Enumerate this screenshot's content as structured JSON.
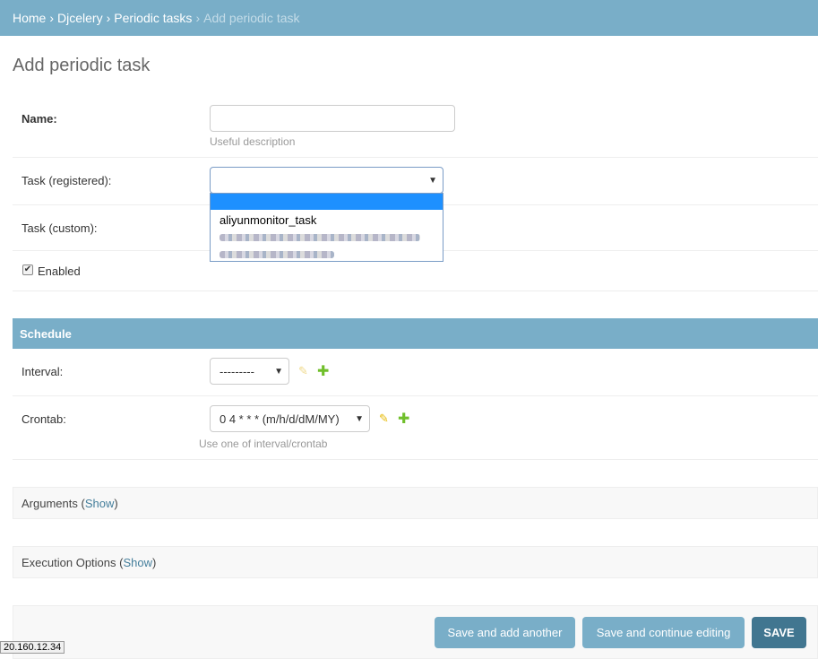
{
  "breadcrumb": {
    "home": "Home",
    "app": "Djcelery",
    "model": "Periodic tasks",
    "current": "Add periodic task",
    "separator": "›"
  },
  "page_title": "Add periodic task",
  "form": {
    "name": {
      "label": "Name:",
      "value": "",
      "help": "Useful description"
    },
    "task_registered": {
      "label": "Task (registered):",
      "selected": "",
      "options": [
        "",
        "aliyunmonitor_task"
      ]
    },
    "task_custom": {
      "label": "Task (custom):"
    },
    "enabled": {
      "label": "Enabled",
      "checked": true,
      "check_mark": "✔"
    }
  },
  "schedule": {
    "caption": "Schedule",
    "interval": {
      "label": "Interval:",
      "selected": "---------"
    },
    "crontab": {
      "label": "Crontab:",
      "selected": "0 4 * * * (m/h/d/dM/MY)",
      "help": "Use one of interval/crontab"
    }
  },
  "icons": {
    "select_arrow": "▼",
    "pencil": "✎",
    "plus": "✚"
  },
  "collapsibles": {
    "arguments": {
      "title": "Arguments",
      "open_paren": "(",
      "toggle": "Show",
      "close_paren": ")"
    },
    "execution": {
      "title": "Execution Options",
      "open_paren": "(",
      "toggle": "Show",
      "close_paren": ")"
    }
  },
  "buttons": {
    "save_add_another": "Save and add another",
    "save_continue": "Save and continue editing",
    "save": "SAVE"
  },
  "status_tooltip": "20.160.12.34",
  "colors": {
    "header": "#79aec8",
    "primary_button": "#417690",
    "link": "#447e9b",
    "add_icon": "#70bf2b",
    "highlight": "#1e90ff"
  }
}
